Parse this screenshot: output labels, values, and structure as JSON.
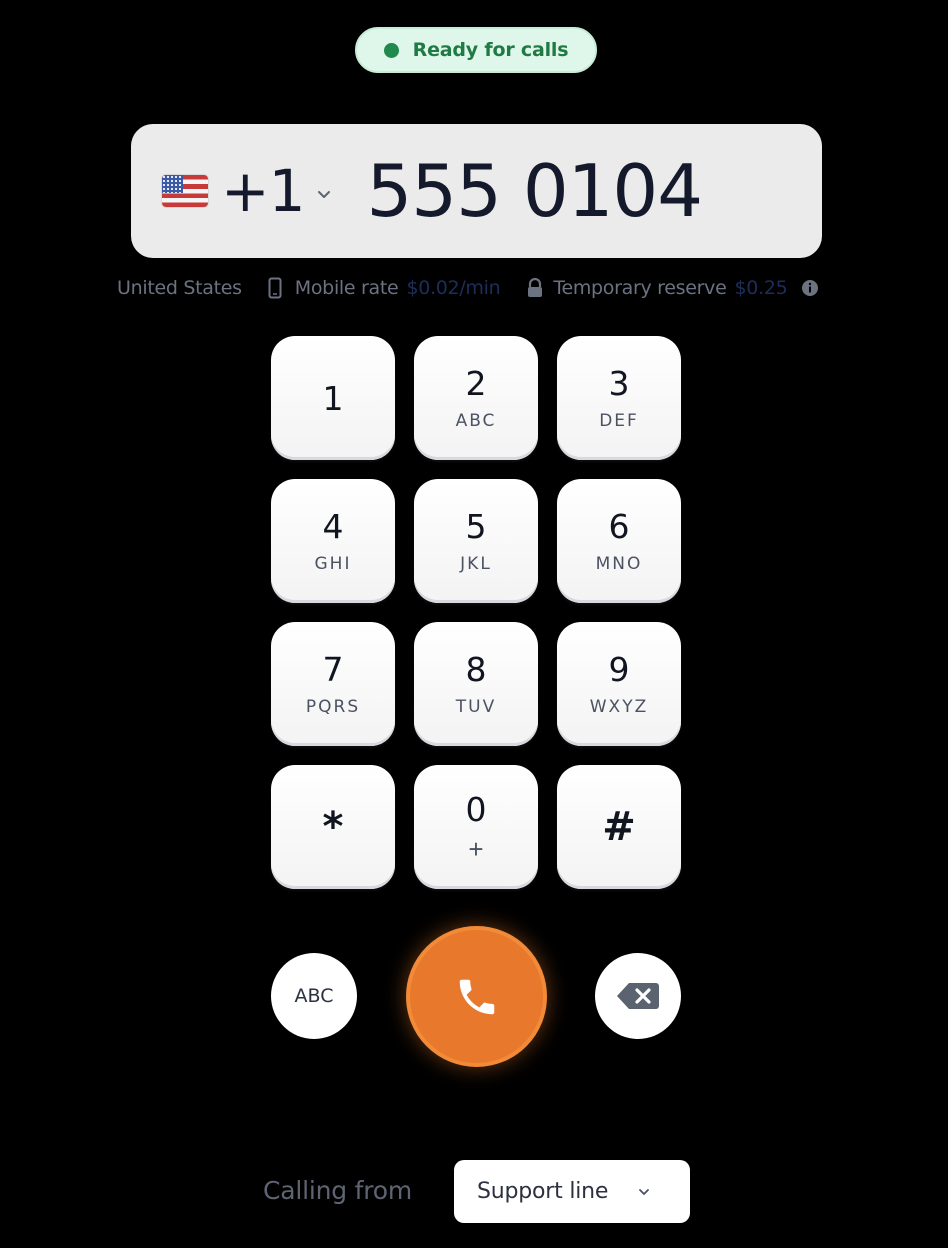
{
  "status": {
    "label": "Ready for calls",
    "color": "#1f8a4c"
  },
  "dialer": {
    "country_flag_icon": "us-flag-icon",
    "country_code": "+1",
    "number": "555 0104"
  },
  "info": {
    "country": "United States",
    "rate_label": "Mobile rate",
    "rate_value": "$0.02/min",
    "reserve_label": "Temporary reserve",
    "reserve_value": "$0.25"
  },
  "keypad": {
    "keys": [
      {
        "digit": "1",
        "letters": ""
      },
      {
        "digit": "2",
        "letters": "ABC"
      },
      {
        "digit": "3",
        "letters": "DEF"
      },
      {
        "digit": "4",
        "letters": "GHI"
      },
      {
        "digit": "5",
        "letters": "JKL"
      },
      {
        "digit": "6",
        "letters": "MNO"
      },
      {
        "digit": "7",
        "letters": "PQRS"
      },
      {
        "digit": "8",
        "letters": "TUV"
      },
      {
        "digit": "9",
        "letters": "WXYZ"
      },
      {
        "digit": "*",
        "letters": ""
      },
      {
        "digit": "0",
        "letters": "+"
      },
      {
        "digit": "#",
        "letters": ""
      }
    ]
  },
  "actions": {
    "abc_label": "ABC",
    "call_icon": "phone-icon",
    "call_color": "#e8792c",
    "backspace_icon": "backspace-icon"
  },
  "calling_from": {
    "label": "Calling from",
    "selected_line": "Support line"
  }
}
